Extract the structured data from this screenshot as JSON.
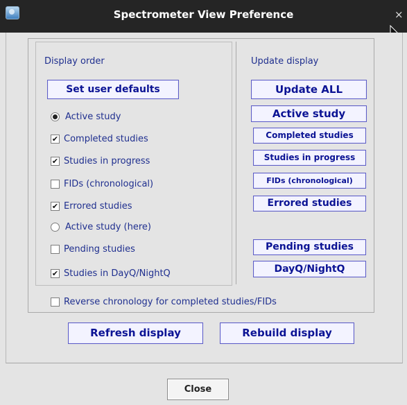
{
  "window": {
    "title": "Spectrometer View Preference",
    "close_glyph": "×"
  },
  "display_order": {
    "heading": "Display order",
    "set_defaults_label": "Set user defaults",
    "options": [
      {
        "label": "Active study",
        "type": "radio",
        "selected": true
      },
      {
        "label": "Completed studies",
        "type": "checkbox",
        "checked": true
      },
      {
        "label": "Studies in progress",
        "type": "checkbox",
        "checked": true
      },
      {
        "label": "FIDs (chronological)",
        "type": "checkbox",
        "checked": false
      },
      {
        "label": "Errored studies",
        "type": "checkbox",
        "checked": true
      },
      {
        "label": "Active study (here)",
        "type": "radio",
        "selected": false
      },
      {
        "label": "Pending studies",
        "type": "checkbox",
        "checked": false
      },
      {
        "label": "Studies in DayQ/NightQ",
        "type": "checkbox",
        "checked": true
      }
    ],
    "reverse_option": {
      "label": "Reverse chronology for completed studies/FIDs",
      "checked": false
    }
  },
  "update_display": {
    "heading": "Update display",
    "buttons": [
      "Update ALL",
      "Active study",
      "Completed studies",
      "Studies in progress",
      "FIDs (chronological)",
      "Errored studies",
      "Pending studies",
      "DayQ/NightQ"
    ]
  },
  "actions": {
    "refresh_label": "Refresh display",
    "rebuild_label": "Rebuild display"
  },
  "footer": {
    "close_label": "Close"
  },
  "colors": {
    "label_text": "#1f2f8f",
    "button_text": "#0b1394",
    "button_border": "#5c5cc5",
    "titlebar": "#252525"
  }
}
